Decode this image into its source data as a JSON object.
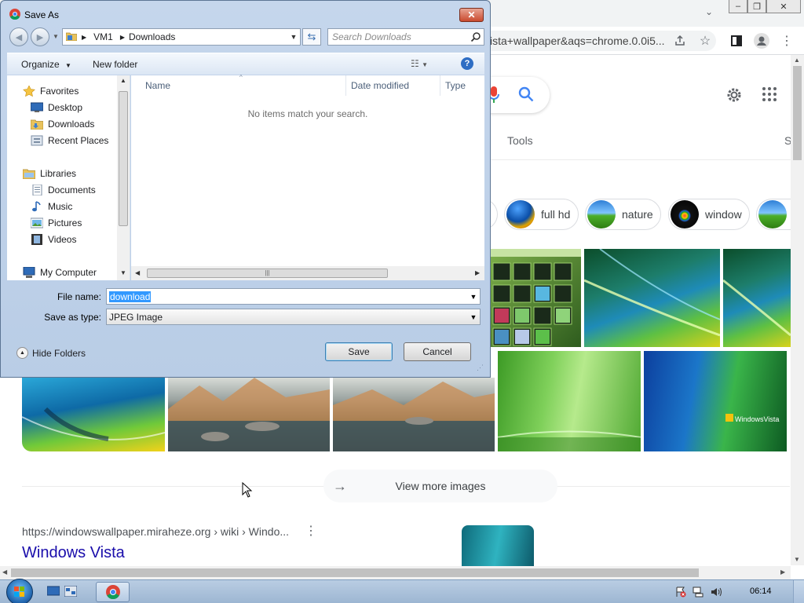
{
  "dialog": {
    "title": "Save As",
    "nav_back": "◀",
    "nav_forward": "▶",
    "breadcrumb": [
      "VM1",
      "Downloads"
    ],
    "search_placeholder": "Search Downloads",
    "organize_label": "Organize",
    "new_folder_label": "New folder",
    "nav_groups": [
      {
        "label": "Favorites",
        "items": [
          "Desktop",
          "Downloads",
          "Recent Places"
        ]
      },
      {
        "label": "Libraries",
        "items": [
          "Documents",
          "Music",
          "Pictures",
          "Videos"
        ]
      },
      {
        "label": "My Computer",
        "items": []
      }
    ],
    "columns": [
      "Name",
      "Date modified",
      "Type"
    ],
    "empty_message": "No items match your search.",
    "file_name_label": "File name:",
    "file_name_value": "download",
    "save_as_type_label": "Save as type:",
    "save_as_type_value": "JPEG Image",
    "hide_folders_label": "Hide Folders",
    "save_label": "Save",
    "cancel_label": "Cancel",
    "colors": {
      "accent": "#3399ff",
      "close": "#c94a2e"
    }
  },
  "browser": {
    "omnibox_text": "ista+wallpaper&aqs=chrome.0.0i5...",
    "tools_label": "Tools",
    "tools_trailing": "S",
    "chips": [
      "full hd",
      "nature",
      "window"
    ],
    "view_more_label": "View more images",
    "result_url": "https://windowswallpaper.miraheze.org › wiki › Windo...",
    "result_title": "Windows Vista",
    "vista_watermark": "WindowsVista",
    "colors": {
      "link": "#1a0dab",
      "mic": "#ea4335",
      "search": "#4285f4"
    }
  },
  "taskbar": {
    "time": "06:14"
  }
}
